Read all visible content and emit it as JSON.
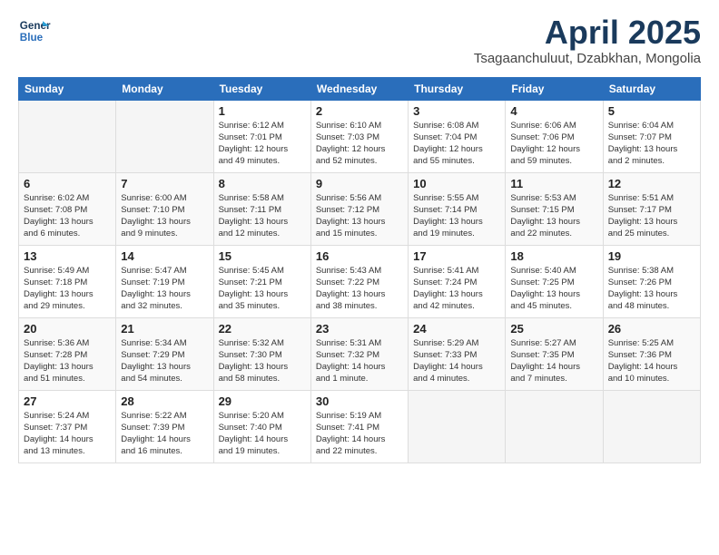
{
  "logo": {
    "line1": "General",
    "line2": "Blue"
  },
  "title": "April 2025",
  "subtitle": "Tsagaanchuluut, Dzabkhan, Mongolia",
  "days_of_week": [
    "Sunday",
    "Monday",
    "Tuesday",
    "Wednesday",
    "Thursday",
    "Friday",
    "Saturday"
  ],
  "weeks": [
    [
      {
        "num": "",
        "info": ""
      },
      {
        "num": "",
        "info": ""
      },
      {
        "num": "1",
        "info": "Sunrise: 6:12 AM\nSunset: 7:01 PM\nDaylight: 12 hours\nand 49 minutes."
      },
      {
        "num": "2",
        "info": "Sunrise: 6:10 AM\nSunset: 7:03 PM\nDaylight: 12 hours\nand 52 minutes."
      },
      {
        "num": "3",
        "info": "Sunrise: 6:08 AM\nSunset: 7:04 PM\nDaylight: 12 hours\nand 55 minutes."
      },
      {
        "num": "4",
        "info": "Sunrise: 6:06 AM\nSunset: 7:06 PM\nDaylight: 12 hours\nand 59 minutes."
      },
      {
        "num": "5",
        "info": "Sunrise: 6:04 AM\nSunset: 7:07 PM\nDaylight: 13 hours\nand 2 minutes."
      }
    ],
    [
      {
        "num": "6",
        "info": "Sunrise: 6:02 AM\nSunset: 7:08 PM\nDaylight: 13 hours\nand 6 minutes."
      },
      {
        "num": "7",
        "info": "Sunrise: 6:00 AM\nSunset: 7:10 PM\nDaylight: 13 hours\nand 9 minutes."
      },
      {
        "num": "8",
        "info": "Sunrise: 5:58 AM\nSunset: 7:11 PM\nDaylight: 13 hours\nand 12 minutes."
      },
      {
        "num": "9",
        "info": "Sunrise: 5:56 AM\nSunset: 7:12 PM\nDaylight: 13 hours\nand 15 minutes."
      },
      {
        "num": "10",
        "info": "Sunrise: 5:55 AM\nSunset: 7:14 PM\nDaylight: 13 hours\nand 19 minutes."
      },
      {
        "num": "11",
        "info": "Sunrise: 5:53 AM\nSunset: 7:15 PM\nDaylight: 13 hours\nand 22 minutes."
      },
      {
        "num": "12",
        "info": "Sunrise: 5:51 AM\nSunset: 7:17 PM\nDaylight: 13 hours\nand 25 minutes."
      }
    ],
    [
      {
        "num": "13",
        "info": "Sunrise: 5:49 AM\nSunset: 7:18 PM\nDaylight: 13 hours\nand 29 minutes."
      },
      {
        "num": "14",
        "info": "Sunrise: 5:47 AM\nSunset: 7:19 PM\nDaylight: 13 hours\nand 32 minutes."
      },
      {
        "num": "15",
        "info": "Sunrise: 5:45 AM\nSunset: 7:21 PM\nDaylight: 13 hours\nand 35 minutes."
      },
      {
        "num": "16",
        "info": "Sunrise: 5:43 AM\nSunset: 7:22 PM\nDaylight: 13 hours\nand 38 minutes."
      },
      {
        "num": "17",
        "info": "Sunrise: 5:41 AM\nSunset: 7:24 PM\nDaylight: 13 hours\nand 42 minutes."
      },
      {
        "num": "18",
        "info": "Sunrise: 5:40 AM\nSunset: 7:25 PM\nDaylight: 13 hours\nand 45 minutes."
      },
      {
        "num": "19",
        "info": "Sunrise: 5:38 AM\nSunset: 7:26 PM\nDaylight: 13 hours\nand 48 minutes."
      }
    ],
    [
      {
        "num": "20",
        "info": "Sunrise: 5:36 AM\nSunset: 7:28 PM\nDaylight: 13 hours\nand 51 minutes."
      },
      {
        "num": "21",
        "info": "Sunrise: 5:34 AM\nSunset: 7:29 PM\nDaylight: 13 hours\nand 54 minutes."
      },
      {
        "num": "22",
        "info": "Sunrise: 5:32 AM\nSunset: 7:30 PM\nDaylight: 13 hours\nand 58 minutes."
      },
      {
        "num": "23",
        "info": "Sunrise: 5:31 AM\nSunset: 7:32 PM\nDaylight: 14 hours\nand 1 minute."
      },
      {
        "num": "24",
        "info": "Sunrise: 5:29 AM\nSunset: 7:33 PM\nDaylight: 14 hours\nand 4 minutes."
      },
      {
        "num": "25",
        "info": "Sunrise: 5:27 AM\nSunset: 7:35 PM\nDaylight: 14 hours\nand 7 minutes."
      },
      {
        "num": "26",
        "info": "Sunrise: 5:25 AM\nSunset: 7:36 PM\nDaylight: 14 hours\nand 10 minutes."
      }
    ],
    [
      {
        "num": "27",
        "info": "Sunrise: 5:24 AM\nSunset: 7:37 PM\nDaylight: 14 hours\nand 13 minutes."
      },
      {
        "num": "28",
        "info": "Sunrise: 5:22 AM\nSunset: 7:39 PM\nDaylight: 14 hours\nand 16 minutes."
      },
      {
        "num": "29",
        "info": "Sunrise: 5:20 AM\nSunset: 7:40 PM\nDaylight: 14 hours\nand 19 minutes."
      },
      {
        "num": "30",
        "info": "Sunrise: 5:19 AM\nSunset: 7:41 PM\nDaylight: 14 hours\nand 22 minutes."
      },
      {
        "num": "",
        "info": ""
      },
      {
        "num": "",
        "info": ""
      },
      {
        "num": "",
        "info": ""
      }
    ]
  ]
}
